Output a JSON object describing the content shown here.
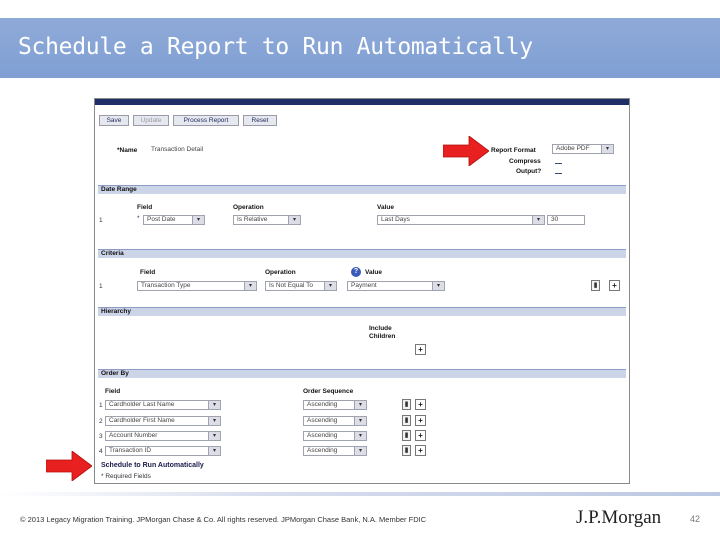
{
  "slide": {
    "title": "Schedule a Report to Run Automatically",
    "footer": "© 2013 Legacy Migration Training. JPMorgan Chase & Co. All rights reserved. JPMorgan Chase Bank, N.A. Member FDIC",
    "logo": "J.P.Morgan",
    "page": "42"
  },
  "toolbar": {
    "save": "Save",
    "update": "Update",
    "process_report": "Process Report",
    "reset": "Reset"
  },
  "report": {
    "name_label": "*Name",
    "name_value": "Transaction Detail",
    "format_label": "Report Format",
    "format_value": "Adobe PDF",
    "compress_label": "Compress",
    "output_label": "Output?"
  },
  "date_range": {
    "title": "Date Range",
    "headers": {
      "field": "Field",
      "operation": "Operation",
      "value": "Value"
    },
    "row": {
      "num": "1",
      "marker": "*",
      "field": "Post Date",
      "operation": "Is Relative",
      "value": "Last Days",
      "days": "30"
    }
  },
  "criteria": {
    "title": "Criteria",
    "headers": {
      "field": "Field",
      "operation": "Operation",
      "value": "Value"
    },
    "row": {
      "num": "1",
      "field": "Transaction Type",
      "operation": "Is Not Equal To",
      "value": "Payment"
    }
  },
  "hierarchy": {
    "title": "Hierarchy",
    "include_children": "Include Children"
  },
  "order_by": {
    "title": "Order By",
    "headers": {
      "field": "Field",
      "sequence": "Order Sequence"
    },
    "rows": [
      {
        "num": "1",
        "field": "Cardholder Last Name",
        "sequence": "Ascending"
      },
      {
        "num": "2",
        "field": "Cardholder First Name",
        "sequence": "Ascending"
      },
      {
        "num": "3",
        "field": "Account Number",
        "sequence": "Ascending"
      },
      {
        "num": "4",
        "field": "Transaction ID",
        "sequence": "Ascending"
      }
    ]
  },
  "schedule": {
    "link": "Schedule to Run Automatically",
    "required": "* Required Fields"
  },
  "icons": {
    "dropdown": "chevron-down-icon",
    "add": "plus-icon",
    "delete": "trash-icon",
    "help": "help-icon",
    "pointer": "red-arrow-icon"
  },
  "colors": {
    "header_band": "#8faad8",
    "section_bar": "#ccd4e8",
    "arrow": "#e8201f"
  }
}
